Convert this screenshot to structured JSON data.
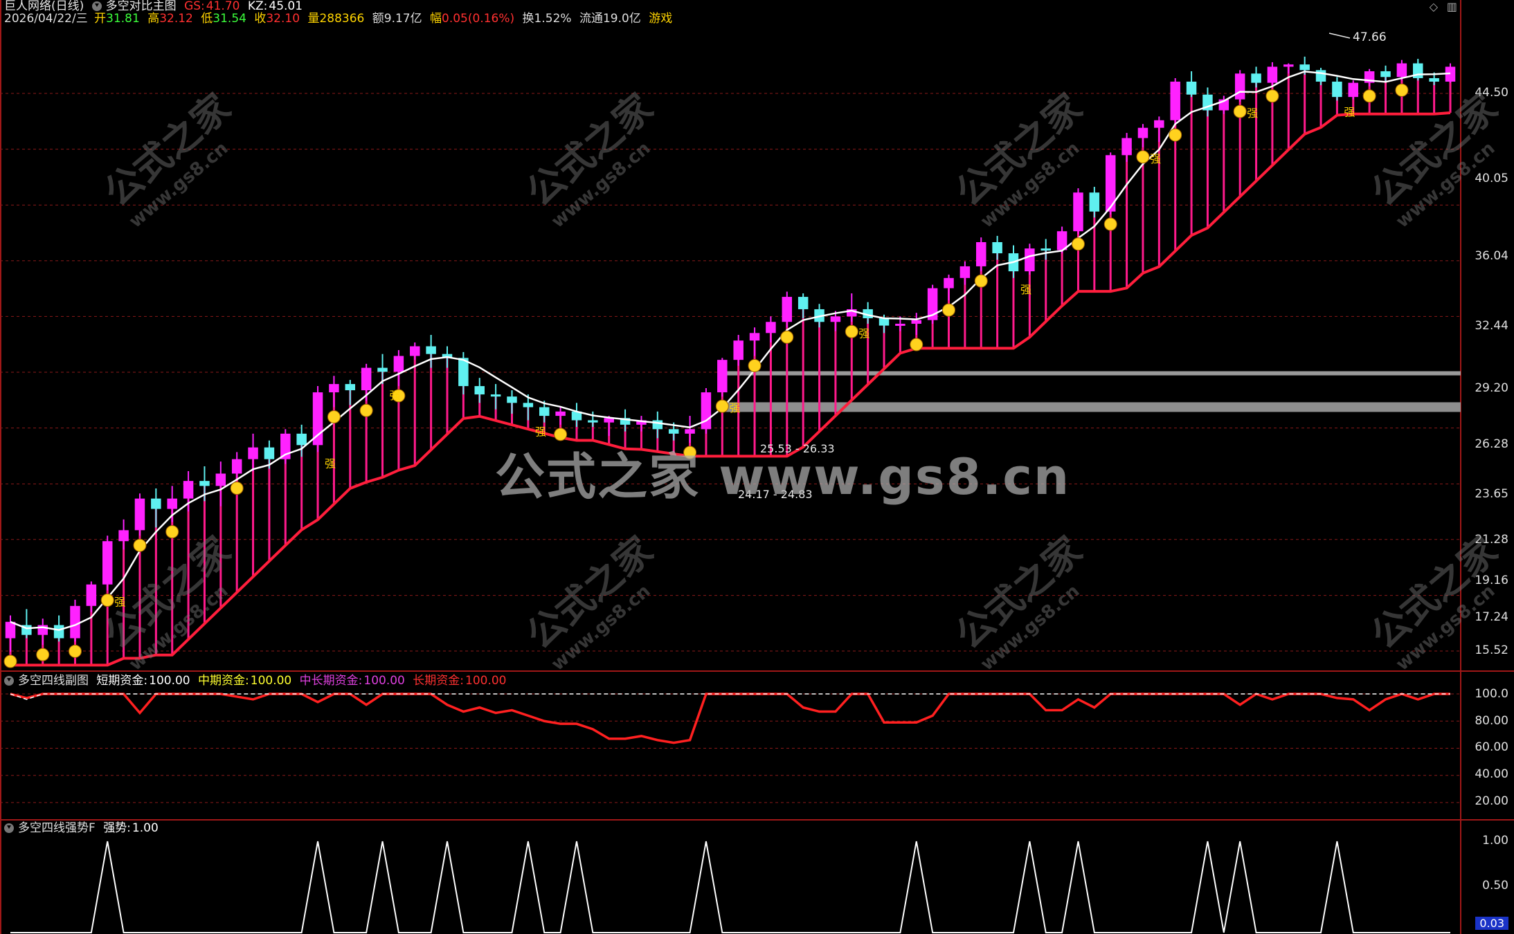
{
  "main": {
    "title_stock": "巨人网络(日线)",
    "title_indicator": "多空对比主图",
    "gs_label": "GS:",
    "gs_value": "41.70",
    "kz_label": "KZ:",
    "kz_value": "45.01",
    "quote": {
      "date": "2026/04/22/三",
      "open_label": "开",
      "open": "31.81",
      "high_label": "高",
      "high": "32.12",
      "low_label": "低",
      "low": "31.54",
      "close_label": "收",
      "close": "32.10",
      "vol_label": "量",
      "vol": "288366",
      "amt_label": "额",
      "amt": "9.17亿",
      "chg_label": "幅",
      "chg": "0.05(0.16%)",
      "turn_label": "换",
      "turn": "1.52%",
      "float_label": "流通",
      "float": "19.0亿",
      "game": "游戏"
    },
    "y_ticks": [
      "44.50",
      "40.05",
      "36.04",
      "32.44",
      "29.20",
      "26.28",
      "23.65",
      "21.28",
      "19.16",
      "17.24",
      "15.52"
    ],
    "high_marker": "47.66",
    "zone_upper_label": "25.53 - 26.33",
    "zone_lower_label": "24.17 - 24.83",
    "strong_char": "强",
    "watermark_text": "公式之家",
    "watermark_url": "www.gs8.cn",
    "big_watermark": "公式之家 www.gs8.cn",
    "colors": {
      "up": "#ff22ff",
      "down": "#5ff0f0",
      "support": "#ff1e3c",
      "ma": "#ffffff"
    }
  },
  "sub1": {
    "title": "多空四线副图",
    "short_label": "短期资金:",
    "short_value": "100.00",
    "mid_label": "中期资金:",
    "mid_value": "100.00",
    "midlong_label": "中长期资金:",
    "midlong_value": "100.00",
    "long_label": "长期资金:",
    "long_value": "100.00",
    "y_ticks": [
      "100.0",
      "80.00",
      "60.00",
      "40.00",
      "20.00"
    ]
  },
  "sub2": {
    "title": "多空四线强势F",
    "strength_label": "强势:",
    "strength_value": "1.00",
    "y_ticks": [
      "1.00",
      "0.50"
    ],
    "cursor_value": "0.03"
  },
  "chart_data": {
    "type": "candlestick",
    "title": "",
    "price_ticks": [
      44.5,
      40.05,
      36.04,
      32.44,
      29.2,
      26.28,
      23.65,
      21.28,
      19.16,
      17.24,
      15.52
    ],
    "ohlc": [
      [
        15.9,
        16.6,
        15.5,
        16.4
      ],
      [
        16.3,
        16.8,
        15.9,
        16.0
      ],
      [
        16.0,
        16.5,
        15.7,
        16.3
      ],
      [
        16.3,
        16.6,
        15.8,
        15.9
      ],
      [
        15.9,
        17.1,
        15.8,
        16.9
      ],
      [
        16.9,
        17.7,
        16.7,
        17.6
      ],
      [
        17.6,
        19.3,
        17.4,
        19.1
      ],
      [
        19.1,
        19.9,
        18.8,
        19.5
      ],
      [
        19.5,
        20.9,
        19.3,
        20.7
      ],
      [
        20.7,
        21.1,
        19.6,
        20.3
      ],
      [
        20.3,
        21.2,
        19.8,
        20.7
      ],
      [
        20.7,
        21.8,
        20.2,
        21.4
      ],
      [
        21.4,
        22.0,
        20.6,
        21.2
      ],
      [
        21.2,
        22.2,
        20.4,
        21.7
      ],
      [
        21.7,
        22.6,
        21.5,
        22.3
      ],
      [
        22.3,
        23.4,
        21.8,
        22.8
      ],
      [
        22.8,
        23.1,
        21.9,
        22.3
      ],
      [
        22.3,
        23.6,
        22.1,
        23.4
      ],
      [
        23.4,
        23.8,
        22.4,
        22.9
      ],
      [
        22.9,
        25.6,
        22.6,
        25.3
      ],
      [
        25.3,
        26.1,
        24.6,
        25.7
      ],
      [
        25.7,
        25.9,
        24.7,
        25.4
      ],
      [
        25.4,
        26.7,
        24.9,
        26.5
      ],
      [
        26.5,
        27.2,
        25.7,
        26.3
      ],
      [
        26.3,
        27.4,
        25.6,
        27.1
      ],
      [
        27.1,
        27.8,
        26.9,
        27.6
      ],
      [
        27.6,
        28.2,
        26.5,
        27.2
      ],
      [
        27.2,
        27.6,
        26.5,
        27.0
      ],
      [
        27.0,
        27.3,
        25.2,
        25.6
      ],
      [
        25.6,
        26.0,
        24.8,
        25.2
      ],
      [
        25.2,
        25.7,
        24.5,
        25.1
      ],
      [
        25.1,
        25.4,
        24.3,
        24.8
      ],
      [
        24.8,
        25.2,
        24.0,
        24.6
      ],
      [
        24.6,
        24.9,
        23.9,
        24.2
      ],
      [
        24.2,
        24.6,
        23.8,
        24.4
      ],
      [
        24.4,
        24.8,
        23.7,
        24.0
      ],
      [
        24.0,
        24.4,
        23.7,
        23.9
      ],
      [
        23.9,
        24.2,
        23.3,
        24.1
      ],
      [
        24.1,
        24.5,
        23.5,
        23.8
      ],
      [
        23.8,
        24.2,
        23.5,
        24.0
      ],
      [
        24.0,
        24.4,
        23.2,
        23.6
      ],
      [
        23.6,
        23.9,
        23.1,
        23.4
      ],
      [
        23.4,
        24.2,
        23.0,
        23.6
      ],
      [
        23.6,
        25.5,
        23.4,
        25.3
      ],
      [
        25.3,
        27.0,
        25.1,
        26.9
      ],
      [
        26.9,
        28.2,
        26.6,
        27.9
      ],
      [
        27.9,
        28.6,
        27.1,
        28.3
      ],
      [
        28.3,
        29.2,
        27.8,
        28.9
      ],
      [
        28.9,
        30.6,
        28.6,
        30.3
      ],
      [
        30.3,
        30.5,
        29.1,
        29.6
      ],
      [
        29.6,
        29.9,
        28.6,
        28.9
      ],
      [
        28.9,
        29.5,
        28.4,
        29.2
      ],
      [
        29.2,
        30.5,
        28.9,
        29.6
      ],
      [
        29.6,
        30.0,
        28.8,
        29.1
      ],
      [
        29.1,
        29.3,
        28.3,
        28.7
      ],
      [
        28.7,
        29.2,
        28.4,
        28.8
      ],
      [
        28.8,
        29.4,
        28.2,
        29.0
      ],
      [
        29.0,
        31.0,
        28.8,
        30.8
      ],
      [
        30.8,
        31.6,
        30.1,
        31.4
      ],
      [
        31.4,
        32.4,
        31.0,
        32.1
      ],
      [
        32.1,
        33.9,
        31.8,
        33.6
      ],
      [
        33.6,
        34.0,
        32.5,
        32.9
      ],
      [
        32.9,
        33.4,
        31.4,
        31.8
      ],
      [
        31.8,
        33.5,
        31.6,
        33.2
      ],
      [
        33.2,
        33.8,
        32.5,
        33.1
      ],
      [
        33.1,
        34.6,
        32.9,
        34.3
      ],
      [
        34.3,
        37.2,
        34.1,
        36.9
      ],
      [
        36.9,
        37.3,
        35.2,
        35.6
      ],
      [
        35.6,
        39.8,
        35.4,
        39.6
      ],
      [
        39.6,
        41.3,
        39.1,
        40.9
      ],
      [
        40.9,
        42.0,
        40.2,
        41.7
      ],
      [
        41.7,
        42.6,
        40.6,
        42.3
      ],
      [
        42.3,
        45.8,
        41.9,
        45.5
      ],
      [
        45.5,
        46.4,
        44.2,
        44.4
      ],
      [
        44.4,
        45.0,
        42.6,
        43.1
      ],
      [
        43.1,
        44.3,
        42.8,
        44.0
      ],
      [
        44.0,
        46.5,
        43.8,
        46.2
      ],
      [
        46.2,
        46.8,
        45.0,
        45.4
      ],
      [
        45.4,
        47.2,
        45.1,
        46.8
      ],
      [
        46.8,
        47.1,
        46.2,
        47.0
      ],
      [
        47.0,
        47.7,
        46.1,
        46.5
      ],
      [
        46.5,
        46.7,
        45.2,
        45.5
      ],
      [
        45.5,
        45.9,
        43.9,
        44.2
      ],
      [
        44.2,
        45.6,
        44.0,
        45.4
      ],
      [
        45.4,
        46.6,
        45.1,
        46.4
      ],
      [
        46.4,
        46.9,
        45.5,
        45.9
      ],
      [
        45.9,
        47.4,
        45.6,
        47.1
      ],
      [
        47.1,
        47.5,
        45.6,
        45.8
      ],
      [
        45.8,
        46.3,
        45.2,
        45.5
      ],
      [
        45.5,
        47.1,
        45.4,
        46.8
      ]
    ],
    "sub1_series": {
      "short": [
        100,
        96,
        100,
        100,
        100,
        100,
        100,
        100,
        100,
        100,
        100,
        100,
        100,
        100,
        100,
        100,
        100,
        100,
        100,
        100,
        100,
        100,
        100,
        100,
        100,
        100,
        100,
        100,
        100,
        100,
        100,
        100,
        100,
        100,
        100,
        100,
        100,
        100,
        100,
        100,
        100,
        100,
        100,
        100,
        100,
        100,
        100,
        100,
        100,
        100,
        100,
        100,
        100,
        100,
        100,
        100,
        100,
        100,
        100,
        100,
        100,
        100,
        100,
        100,
        100,
        100,
        100,
        100,
        100,
        100,
        100,
        100,
        100,
        100,
        100,
        100,
        100,
        100,
        100,
        100,
        100,
        100,
        100,
        100,
        100,
        100,
        100,
        100,
        100,
        100
      ],
      "long": [
        100,
        97,
        100,
        100,
        100,
        100,
        100,
        100,
        86,
        100,
        100,
        100,
        100,
        100,
        98,
        96,
        100,
        100,
        100,
        94,
        100,
        100,
        92,
        100,
        100,
        100,
        100,
        92,
        87,
        90,
        86,
        88,
        84,
        80,
        78,
        78,
        74,
        67,
        67,
        69,
        66,
        64,
        66,
        100,
        100,
        100,
        100,
        100,
        100,
        90,
        87,
        87,
        100,
        100,
        79,
        79,
        79,
        84,
        100,
        100,
        100,
        100,
        100,
        100,
        88,
        88,
        96,
        90,
        100,
        100,
        100,
        100,
        100,
        100,
        100,
        100,
        92,
        100,
        96,
        100,
        100,
        100,
        97,
        96,
        88,
        96,
        100,
        96,
        100,
        100
      ]
    }
  }
}
